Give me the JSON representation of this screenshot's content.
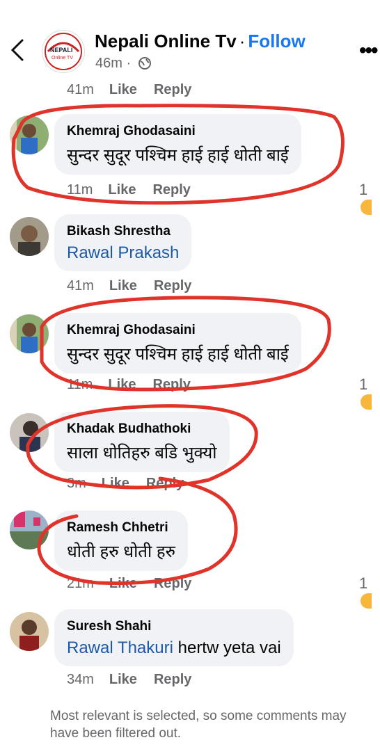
{
  "header": {
    "page_name": "Nepali Online Tv",
    "separator": "·",
    "follow_label": "Follow",
    "time": "46m ·",
    "logo_text_top": "NEPALI",
    "logo_text_bottom": "Online TV"
  },
  "top_actions": {
    "time": "41m",
    "like": "Like",
    "reply": "Reply"
  },
  "comments": [
    {
      "author": "Khemraj Ghodasaini",
      "text": "सुन्दर सुदूर पश्चिम हाई हाई धोती बाई",
      "time": "11m",
      "like": "Like",
      "reply": "Reply",
      "reactions": "1"
    },
    {
      "author": "Bikash Shrestha",
      "mention": "Rawal Prakash",
      "text": "",
      "time": "41m",
      "like": "Like",
      "reply": "Reply"
    },
    {
      "author": "Khemraj Ghodasaini",
      "text": "सुन्दर सुदूर पश्चिम हाई हाई धोती बाई",
      "time": "11m",
      "like": "Like",
      "reply": "Reply",
      "reactions": "1"
    },
    {
      "author": "Khadak Budhathoki",
      "text": "साला धोतिहरु बडि भुक्यो",
      "time": "3m",
      "like": "Like",
      "reply": "Reply"
    },
    {
      "author": "Ramesh Chhetri",
      "text": "धोती हरु धोती हरु",
      "time": "21m",
      "like": "Like",
      "reply": "Reply",
      "reactions": "1"
    },
    {
      "author": "Suresh Shahi",
      "mention": "Rawal Thakuri",
      "text": " hertw yeta vai",
      "time": "34m",
      "like": "Like",
      "reply": "Reply"
    }
  ],
  "footer": {
    "notice": "Most relevant is selected, so some comments may have been filtered out."
  },
  "colors": {
    "link": "#1877f2",
    "annotation": "#e0332a",
    "bubble": "#f0f2f5"
  }
}
